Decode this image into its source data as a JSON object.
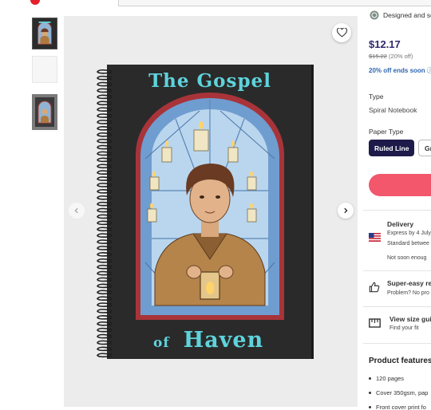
{
  "panel": {
    "designer_text": "Designed and sol",
    "price": "$12.17",
    "original_price": "$15.22",
    "discount": "(20% off)",
    "promo": "20% off ends soon",
    "type_label": "Type",
    "type_value": "Spiral Notebook",
    "paper_label": "Paper Type",
    "paper_options": [
      {
        "label": "Ruled Line",
        "selected": true
      },
      {
        "label": "Gr",
        "selected": false
      }
    ],
    "delivery": {
      "title": "Delivery",
      "express": "Express by 4 July",
      "standard": "Standard betwee",
      "note": "Not soon enoug"
    },
    "returns": {
      "title": "Super-easy ret",
      "sub": "Problem? No pro"
    },
    "size_guide": {
      "title": "View size guid",
      "sub": "Find your fit"
    },
    "features_title": "Product features",
    "features": [
      "120 pages",
      "Cover 350gsm, pap",
      "Front cover print fo"
    ]
  },
  "product_image": {
    "title_top": "The Gospel",
    "title_of": "of",
    "title_bottom": "Haven"
  },
  "icons": {
    "favorite": "heart-icon",
    "prev": "chevron-left-icon",
    "next": "chevron-right-icon",
    "designer": "designer-badge-icon",
    "delivery": "us-flag-icon",
    "returns": "thumbs-up-icon",
    "size_guide": "ruler-icon"
  },
  "colors": {
    "brand_red": "#e4202e",
    "price_navy": "#2d2a6e",
    "promo_blue": "#2f66b0",
    "selected_option": "#1e1b4b",
    "cart_button": "#f2576c",
    "title_cyan": "#5fd3dc"
  }
}
